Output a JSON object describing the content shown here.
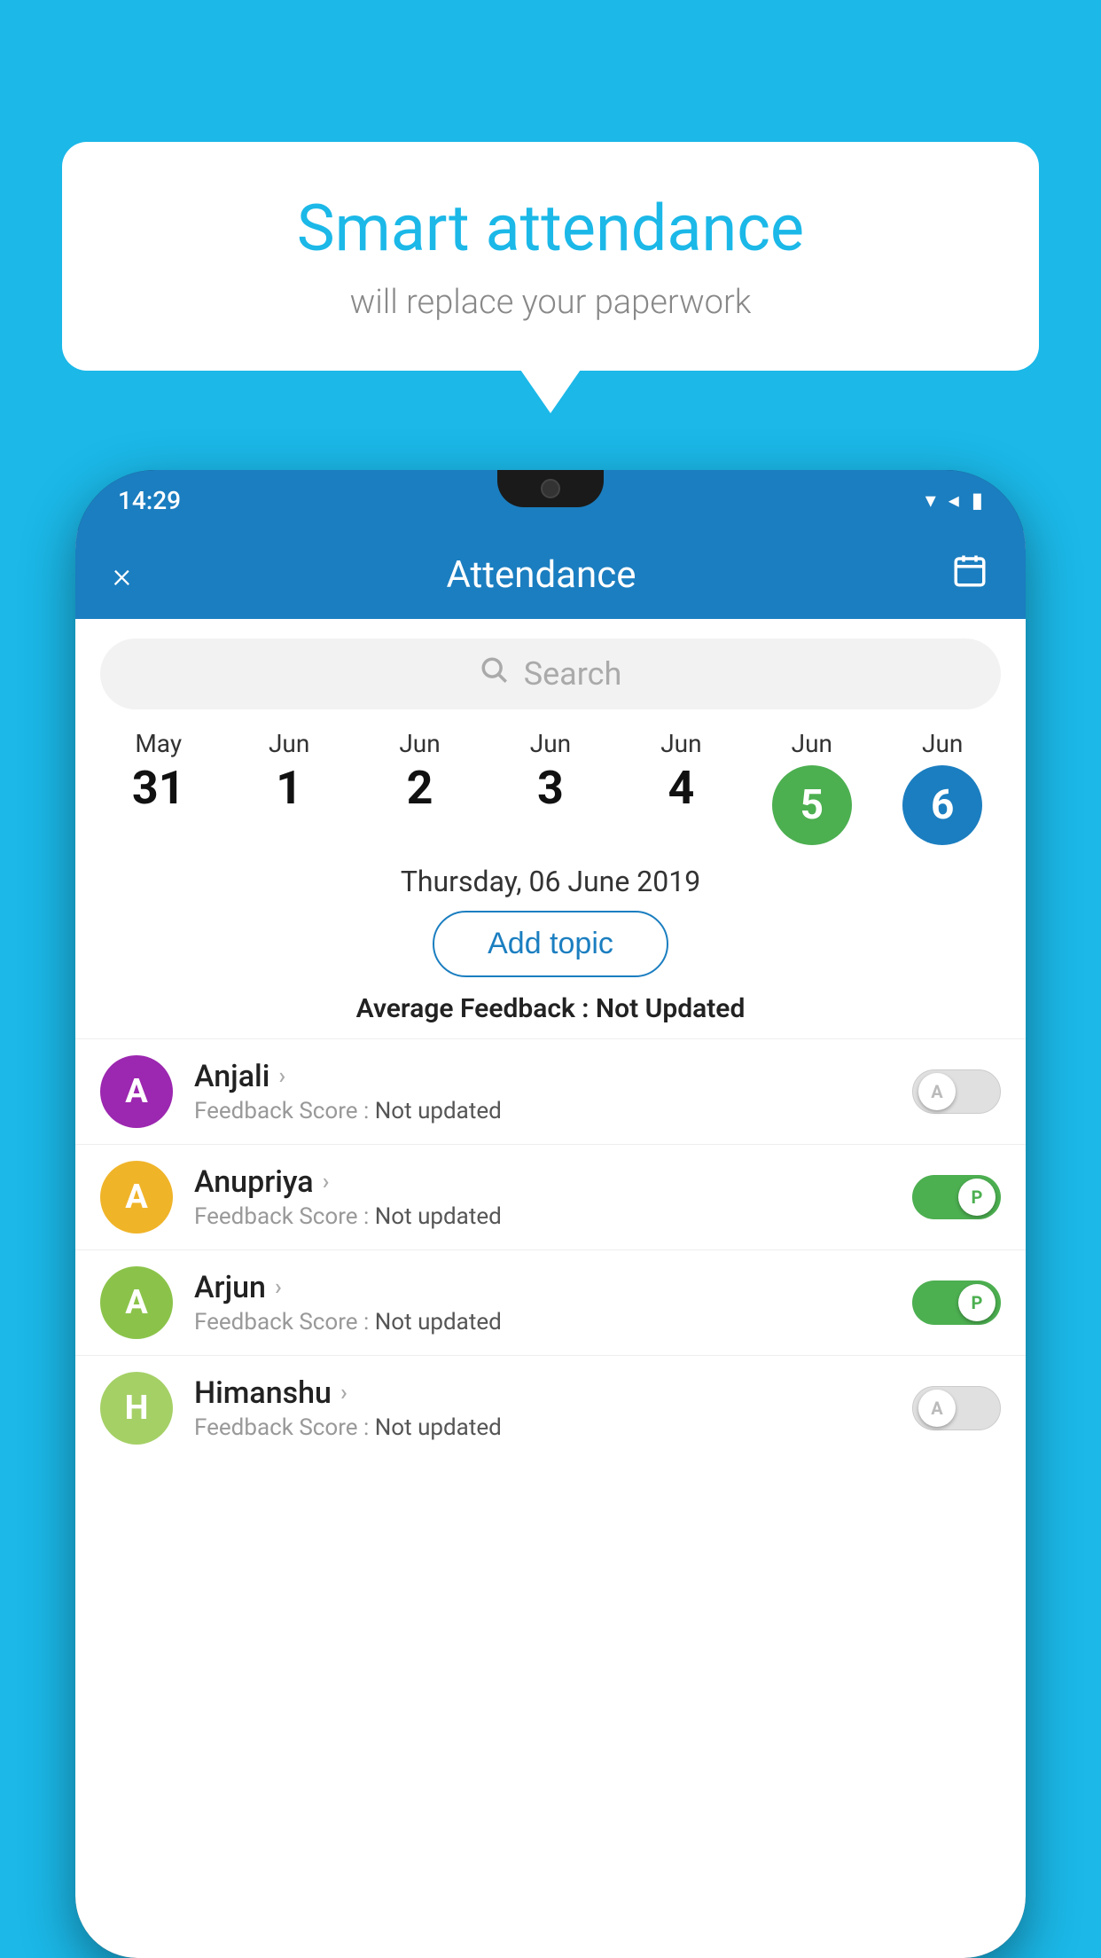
{
  "background_color": "#1bb8e8",
  "bubble": {
    "title": "Smart attendance",
    "subtitle": "will replace your paperwork"
  },
  "status_bar": {
    "time": "14:29",
    "icons": [
      "wifi",
      "signal",
      "battery"
    ]
  },
  "app_header": {
    "title": "Attendance",
    "close_label": "×",
    "calendar_icon": "📅"
  },
  "search": {
    "placeholder": "Search"
  },
  "date_strip": [
    {
      "month": "May",
      "day": "31",
      "state": "normal"
    },
    {
      "month": "Jun",
      "day": "1",
      "state": "normal"
    },
    {
      "month": "Jun",
      "day": "2",
      "state": "normal"
    },
    {
      "month": "Jun",
      "day": "3",
      "state": "normal"
    },
    {
      "month": "Jun",
      "day": "4",
      "state": "normal"
    },
    {
      "month": "Jun",
      "day": "5",
      "state": "today"
    },
    {
      "month": "Jun",
      "day": "6",
      "state": "selected"
    }
  ],
  "selected_date": "Thursday, 06 June 2019",
  "add_topic_label": "Add topic",
  "avg_feedback_label": "Average Feedback :",
  "avg_feedback_value": "Not Updated",
  "students": [
    {
      "name": "Anjali",
      "avatar_letter": "A",
      "avatar_color": "#9c27b0",
      "feedback": "Not updated",
      "toggle": "off",
      "toggle_letter": "A"
    },
    {
      "name": "Anupriya",
      "avatar_letter": "A",
      "avatar_color": "#f0b429",
      "feedback": "Not updated",
      "toggle": "on",
      "toggle_letter": "P"
    },
    {
      "name": "Arjun",
      "avatar_letter": "A",
      "avatar_color": "#8bc34a",
      "feedback": "Not updated",
      "toggle": "on",
      "toggle_letter": "P"
    },
    {
      "name": "Himanshu",
      "avatar_letter": "H",
      "avatar_color": "#a5d066",
      "feedback": "Not updated",
      "toggle": "off",
      "toggle_letter": "A"
    }
  ],
  "feedback_score_label": "Feedback Score : "
}
